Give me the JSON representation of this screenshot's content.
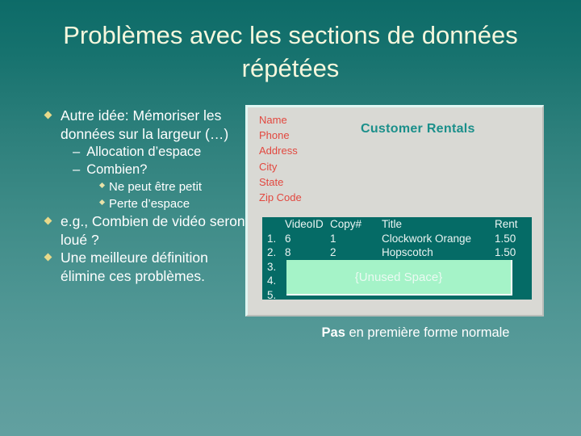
{
  "slide": {
    "title": "Problèmes avec les sections de données répétées",
    "colors": {
      "background_top": "#0d6b68",
      "background_bottom": "#62a0a0",
      "title_text": "#f6f7dd",
      "bullet_diamond": "#e8d98a",
      "panel_background": "#d9d9d4",
      "field_label": "#e2483f",
      "panel_title": "#1a8f8a",
      "table_background": "#056b66",
      "unused_space": "#a5f3c8"
    }
  },
  "bullets": [
    {
      "level": 1,
      "marker": "diamond",
      "text": "Autre idée: Mémoriser les données sur la largeur (…)"
    },
    {
      "level": 2,
      "marker": "dash",
      "text": "Allocation d’espace"
    },
    {
      "level": 2,
      "marker": "dash",
      "text": "Combien?"
    },
    {
      "level": 3,
      "marker": "diamond",
      "text": "Ne peut être petit"
    },
    {
      "level": 3,
      "marker": "diamond",
      "text": "Perte d’espace"
    },
    {
      "level": 1,
      "marker": "diamond",
      "text": "e.g., Combien de vidéo seront loué ?"
    },
    {
      "level": 1,
      "marker": "diamond",
      "text": "Une meilleure définition élimine ces problèmes."
    }
  ],
  "panel": {
    "title": "Customer Rentals",
    "fields": [
      "Name",
      "Phone",
      "Address",
      "City",
      "State",
      "Zip Code"
    ],
    "field_lines": "Name\nPhone\nAddress\nCity\nState\nZip Code",
    "table": {
      "headers": {
        "num": "",
        "id": "VideoID",
        "copy": "Copy#",
        "title": "Title",
        "rent": "Rent"
      },
      "rows": [
        {
          "num": "1.",
          "id": "6",
          "copy": "1",
          "title": "Clockwork Orange",
          "rent": "1.50"
        },
        {
          "num": "2.",
          "id": "8",
          "copy": "2",
          "title": "Hopscotch",
          "rent": "1.50"
        },
        {
          "num": "3.",
          "id": "",
          "copy": "",
          "title": "",
          "rent": ""
        },
        {
          "num": "4.",
          "id": "",
          "copy": "",
          "title": "",
          "rent": ""
        },
        {
          "num": "5.",
          "id": "",
          "copy": "",
          "title": "",
          "rent": ""
        }
      ],
      "unused_space_label": "{Unused Space}"
    }
  },
  "footnote": {
    "emphasis": "Pas",
    "rest": " en première forme normale"
  }
}
